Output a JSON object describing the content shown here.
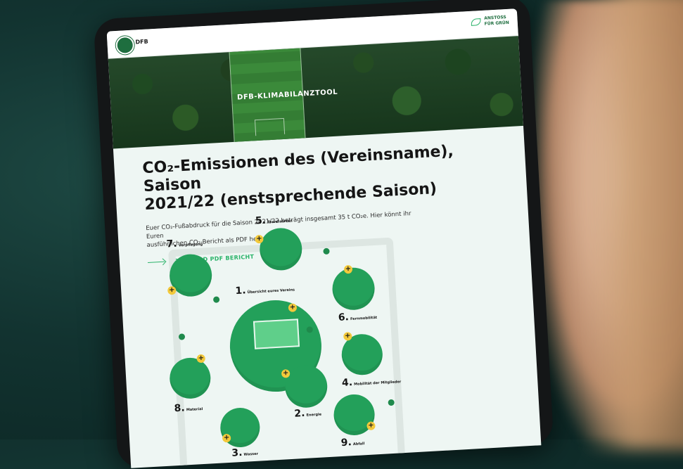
{
  "tablet": {
    "topbar": {
      "brand": "DFB",
      "badge_line1": "ANSTOSS",
      "badge_line2": "FÜR GRÜN"
    },
    "hero": {
      "title": "DFB-KLIMABILANZTOOL"
    },
    "headline_line1": "CO₂-Emissionen des (Vereinsname), Saison",
    "headline_line2": "2021/22 (enstsprechende Saison)",
    "intro_line1": "Euer CO₂-Fußabdruck für die Saison 2021/22 beträgt insgesamt 35 t CO₂e. Hier könnt ihr Euren",
    "intro_line2": "ausführlichen CO₂-Bericht als PDF herunterladen:",
    "download_label": "DOWNLOAD PDF BERICHT",
    "categories": [
      {
        "num": "1.",
        "label": "Übersicht eures Vereins"
      },
      {
        "num": "2.",
        "label": "Energie"
      },
      {
        "num": "3.",
        "label": "Wasser"
      },
      {
        "num": "4.",
        "label": "Mobilität der Mitglieder"
      },
      {
        "num": "5.",
        "label": "Teamfahrten"
      },
      {
        "num": "6.",
        "label": "Fernmobilität"
      },
      {
        "num": "7.",
        "label": "Verpflegung"
      },
      {
        "num": "8.",
        "label": "Material"
      },
      {
        "num": "9.",
        "label": "Abfall"
      }
    ],
    "colors": {
      "accent": "#2bb36a",
      "node": "#23a05a",
      "plus": "#f3c93b"
    }
  }
}
